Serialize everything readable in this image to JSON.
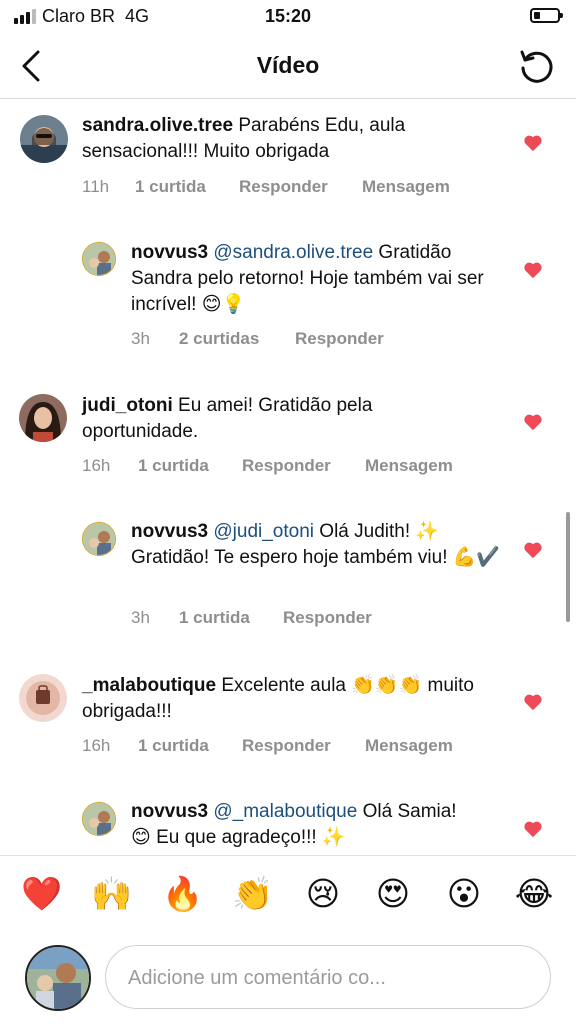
{
  "status_bar": {
    "carrier": "Claro BR",
    "network": "4G",
    "time": "15:20"
  },
  "header": {
    "title": "Vídeo",
    "back_icon": "chevron-left-icon",
    "refresh_icon": "refresh-icon"
  },
  "comments": [
    {
      "user": "sandra.olive.tree",
      "text": "Parabéns Edu, aula sensacional!!! Muito obrigada",
      "time": "11h",
      "likes": "1 curtida",
      "reply": "Responder",
      "message": "Mensagem",
      "liked": true
    },
    {
      "user": "novvus3",
      "mention": "@sandra.olive.tree",
      "text": "Gratidão Sandra pelo retorno! Hoje também vai ser incrível! 😊💡",
      "time": "3h",
      "likes": "2 curtidas",
      "reply": "Responder",
      "liked": true
    },
    {
      "user": "judi_otoni",
      "text": "Eu amei! Gratidão pela oportunidade.",
      "time": "16h",
      "likes": "1 curtida",
      "reply": "Responder",
      "message": "Mensagem",
      "liked": true
    },
    {
      "user": "novvus3",
      "mention": "@judi_otoni",
      "text": "Olá Judith! ✨ Gratidão! Te espero hoje também viu! 💪✔️",
      "time": "3h",
      "likes": "1 curtida",
      "reply": "Responder",
      "liked": true
    },
    {
      "user": "_malaboutique",
      "text": "Excelente aula 👏👏👏 muito obrigada!!!",
      "time": "16h",
      "likes": "1 curtida",
      "reply": "Responder",
      "message": "Mensagem",
      "liked": true
    },
    {
      "user": "novvus3",
      "mention": "@_malaboutique",
      "text": "Olá Samia! 😊 Eu que agradeço!!! ✨",
      "liked": true
    }
  ],
  "emoji_bar": [
    "❤️",
    "🙌",
    "🔥",
    "👏",
    "😢",
    "😍",
    "😮",
    "😂"
  ],
  "comment_input": {
    "placeholder": "Adicione um comentário co..."
  },
  "colors": {
    "heart": "#ed4956",
    "mention": "#1d4f7e",
    "meta": "#8e8e8e"
  }
}
